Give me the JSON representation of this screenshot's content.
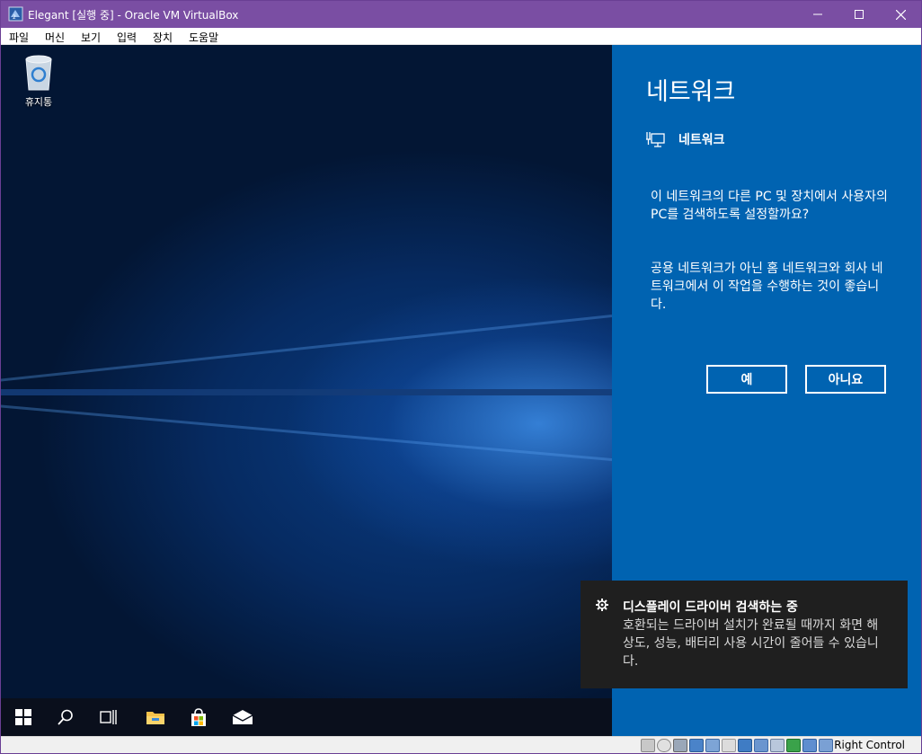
{
  "window": {
    "title": "Elegant [실행 중] - Oracle VM VirtualBox"
  },
  "menu": [
    "파일",
    "머신",
    "보기",
    "입력",
    "장치",
    "도움말"
  ],
  "desktop": {
    "recycle_bin_label": "휴지통"
  },
  "network_panel": {
    "heading": "네트워크",
    "network_name": "네트워크",
    "question": "이 네트워크의 다른 PC 및 장치에서 사용자의 PC를 검색하도록 설정할까요?",
    "note": "공용 네트워크가 아닌 홈 네트워크와 회사 네트워크에서 이 작업을 수행하는 것이 좋습니다.",
    "yes_label": "예",
    "no_label": "아니요",
    "background_color": "#0063b1"
  },
  "toast": {
    "title": "디스플레이 드라이버 검색하는 중",
    "body": "호환되는 드라이버 설치가 완료될 때까지 화면 해상도, 성능, 배터리 사용 시간이 줄어들 수 있습니다."
  },
  "taskbar": {
    "icons": [
      "start-icon",
      "search-icon",
      "task-view-icon",
      "file-explorer-icon",
      "store-icon",
      "mail-icon"
    ]
  },
  "statusbar": {
    "host_key": "Right Control"
  },
  "colors": {
    "titlebar": "#7a4ea3",
    "accent": "#0063b1",
    "taskbar": "#0a0f1c",
    "toast": "#1f1f1f"
  }
}
